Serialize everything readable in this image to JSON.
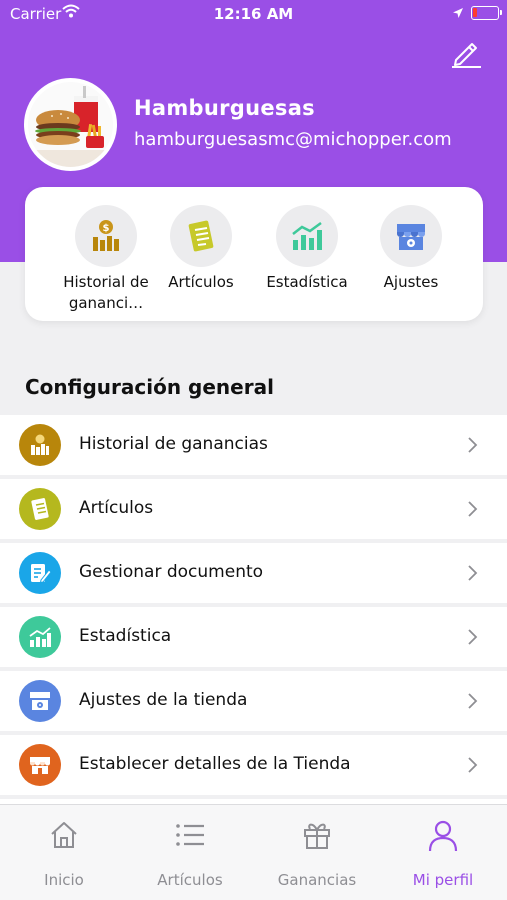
{
  "status_bar": {
    "carrier": "Carrier",
    "time": "12:16 AM",
    "battery_level": 0.15,
    "battery_color": "#ff3b30"
  },
  "colors": {
    "accent": "#9a4fe6",
    "background": "#f0f0f2"
  },
  "profile": {
    "name": "Hamburguesas",
    "email": "hamburguesasmc@michopper.com",
    "edit_icon": "pencil-icon",
    "avatar_image": "burger-meal-photo"
  },
  "shortcuts": [
    {
      "label": "Historial de gananci…",
      "icon": "earnings-history-icon"
    },
    {
      "label": "Artículos",
      "icon": "articles-icon"
    },
    {
      "label": "Estadística",
      "icon": "statistics-icon"
    },
    {
      "label": "Ajustes",
      "icon": "store-settings-icon"
    }
  ],
  "section_title": "Configuración general",
  "settings_items": [
    {
      "label": "Historial de ganancias",
      "icon": "earnings-history-icon",
      "color": "#b8860b"
    },
    {
      "label": "Artículos",
      "icon": "articles-icon",
      "color": "#b5b81e"
    },
    {
      "label": "Gestionar documento",
      "icon": "document-edit-icon",
      "color": "#1aa6e8"
    },
    {
      "label": "Estadística",
      "icon": "statistics-icon",
      "color": "#3ec99a"
    },
    {
      "label": "Ajustes de la tienda",
      "icon": "store-settings-icon",
      "color": "#5a85e0"
    },
    {
      "label": "Establecer detalles de la Tienda",
      "icon": "store-details-icon",
      "color": "#e0641e"
    }
  ],
  "tabs": [
    {
      "label": "Inicio",
      "icon": "home-icon",
      "active": false
    },
    {
      "label": "Artículos",
      "icon": "list-icon",
      "active": false
    },
    {
      "label": "Ganancias",
      "icon": "gift-icon",
      "active": false
    },
    {
      "label": "Mi perfil",
      "icon": "user-icon",
      "active": true
    }
  ]
}
